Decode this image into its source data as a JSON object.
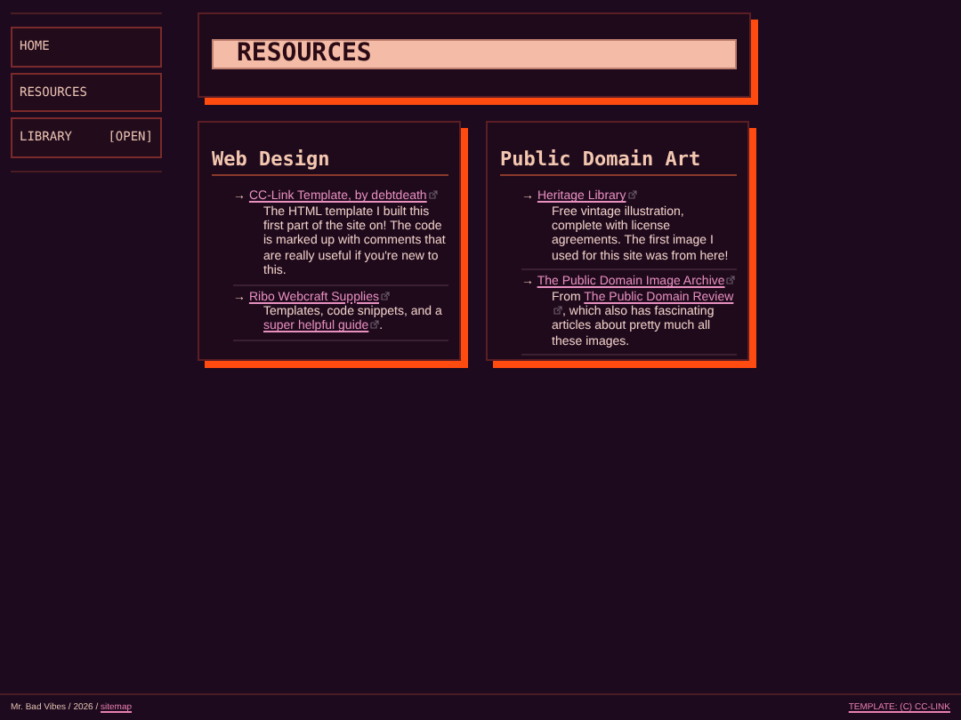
{
  "nav": [
    {
      "label": "HOME"
    },
    {
      "label": "RESOURCES"
    },
    {
      "label": "LIBRARY",
      "tag": "[OPEN]"
    }
  ],
  "header": {
    "title": "RESOURCES"
  },
  "sections": [
    {
      "title": "Web Design",
      "items": [
        {
          "marker": "→",
          "link": "CC-Link Template, by debtdeath",
          "external": true,
          "description": [
            {
              "kind": "text",
              "text": "The HTML template I built this first part of the site on! The code is marked up with comments that are really useful if you're new to this."
            }
          ]
        },
        {
          "marker": "→",
          "link": "Ribo Webcraft Supplies",
          "external": true,
          "description": [
            {
              "kind": "text",
              "text": "Templates, code snippets, and a "
            },
            {
              "kind": "link",
              "text": "super helpful guide",
              "external": true
            },
            {
              "kind": "text",
              "text": "."
            }
          ]
        }
      ]
    },
    {
      "title": "Public Domain Art",
      "items": [
        {
          "marker": "→",
          "link": "Heritage Library",
          "external": true,
          "description": [
            {
              "kind": "text",
              "text": "Free vintage illustration, complete with license agreements. The first image I used for this site was from here!"
            }
          ]
        },
        {
          "marker": "→",
          "link": "The Public Domain Image Archive",
          "external": true,
          "description": [
            {
              "kind": "text",
              "text": "From "
            },
            {
              "kind": "link",
              "text": "The Public Domain Review",
              "external": true
            },
            {
              "kind": "text",
              "text": ", which also has fascinating articles about pretty much all these images."
            }
          ]
        }
      ]
    }
  ],
  "footer": {
    "text": "Mr. Bad Vibes / 2026 / ",
    "link": "sitemap",
    "right_link": "TEMPLATE: (C) CC-LINK"
  }
}
